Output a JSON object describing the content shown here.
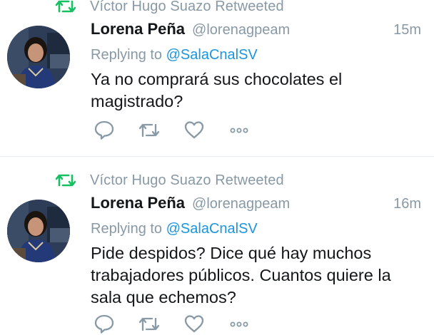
{
  "tweets": [
    {
      "retweeted_by": "Víctor Hugo Suazo Retweeted",
      "display_name": "Lorena Peña",
      "handle": "@lorenagpeam",
      "time": "15m",
      "replying_prefix": "Replying to",
      "replying_to": "@SalaCnalSV",
      "text": "Ya no comprará sus chocolates el magistrado?"
    },
    {
      "retweeted_by": "Víctor Hugo Suazo Retweeted",
      "display_name": "Lorena Peña",
      "handle": "@lorenagpeam",
      "time": "16m",
      "replying_prefix": "Replying to",
      "replying_to": "@SalaCnalSV",
      "text": "Pide despidos? Dice qué hay muchos trabajadores públicos. Cuantos quiere la sala que echemos?"
    }
  ],
  "colors": {
    "retweet_green": "#17bf63",
    "secondary_text": "#8899a6",
    "link_blue": "#1b95e0",
    "primary_text": "#14171a",
    "divider": "#e6ecf0"
  },
  "icons": {
    "retweeted_indicator": "retweet-icon",
    "reply": "reply-icon",
    "retweet": "retweet-icon",
    "like": "heart-icon",
    "more": "more-icon"
  }
}
